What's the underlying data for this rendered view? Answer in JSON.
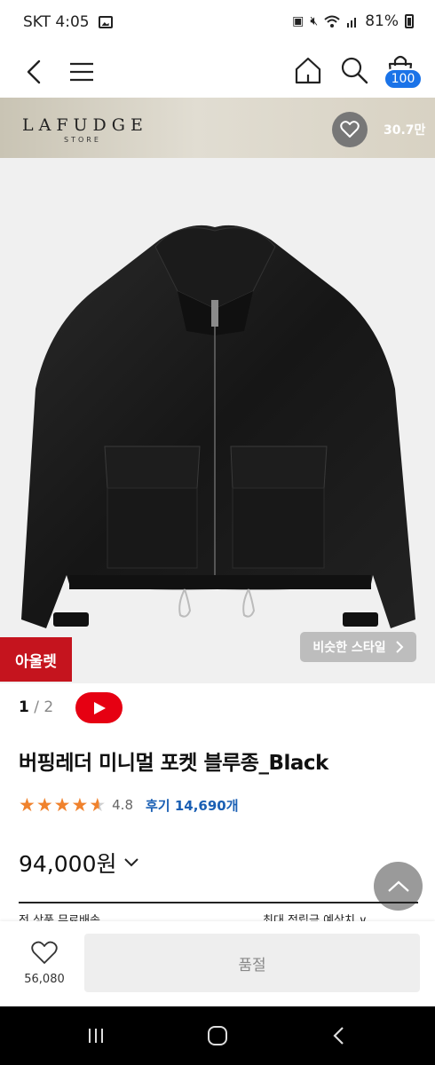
{
  "status_bar": {
    "carrier_time": "SKT 4:05",
    "battery": "81%",
    "icons": [
      "gallery-icon",
      "battery-saver-icon",
      "mute-icon",
      "wifi-icon",
      "signal-icon",
      "battery-icon"
    ]
  },
  "nav": {
    "icons": [
      "back-arrow-icon",
      "menu-icon",
      "home-icon",
      "search-icon",
      "cart-icon"
    ],
    "cart_badge": "100"
  },
  "brand": {
    "name": "LAFUDGE",
    "sub": "STORE",
    "like_count": "30.7만"
  },
  "product": {
    "outlet_label": "아울렛",
    "similar_style_label": "비슷한 스타일",
    "pager": {
      "current": "1",
      "separator": "/",
      "total": "2"
    },
    "title": "버핑레더 미니멀 포켓 블루종_Black",
    "rating": {
      "stars": 4.8,
      "value": "4.8",
      "reviews": "후기 14,690개"
    },
    "price": "94,000원",
    "cutoff_left": "전 상품 무료배송",
    "cutoff_right": "최대 적립금 예상치 ∨"
  },
  "action_bar": {
    "wish_count": "56,080",
    "soldout_label": "품절"
  },
  "colors": {
    "accent_blue": "#1a73e8",
    "outlet_red": "#c5141e",
    "youtube_red": "#e60012",
    "star_orange": "#f0822d",
    "review_blue": "#1a5fb4"
  }
}
